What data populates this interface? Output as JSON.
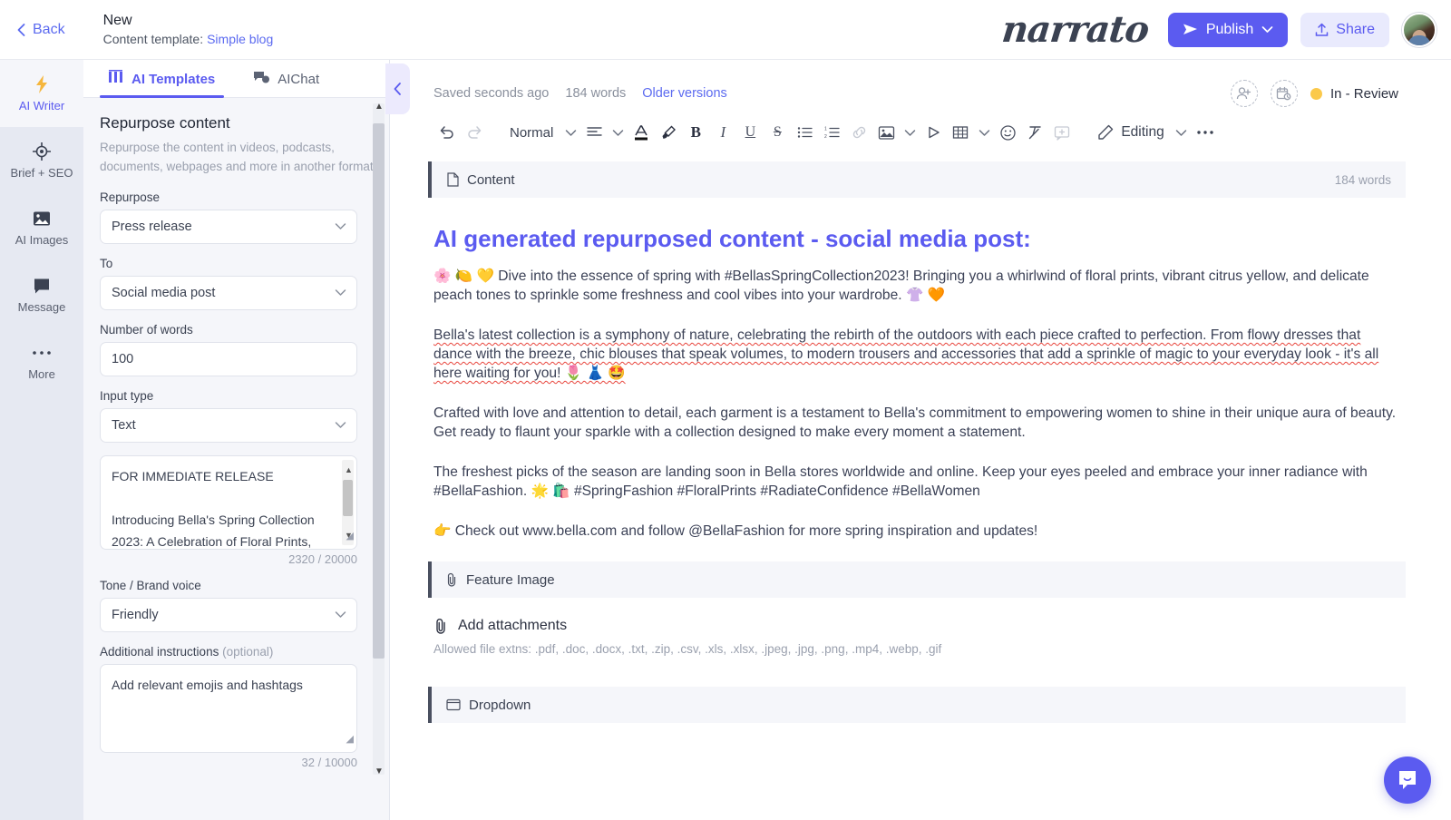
{
  "topbar": {
    "back_label": "Back",
    "doc_title": "New",
    "template_label": "Content template:",
    "template_name": "Simple blog",
    "brand": "narrato",
    "publish_label": "Publish",
    "share_label": "Share",
    "accent": "#5b5bf0"
  },
  "rail": {
    "items": [
      {
        "label": "AI Writer",
        "icon": "lightning-icon",
        "active": true
      },
      {
        "label": "Brief + SEO",
        "icon": "target-icon",
        "active": false
      },
      {
        "label": "AI Images",
        "icon": "image-icon",
        "active": false
      },
      {
        "label": "Message",
        "icon": "chat-icon",
        "active": false
      },
      {
        "label": "More",
        "icon": "ellipsis-icon",
        "active": false
      }
    ]
  },
  "panel": {
    "tabs": [
      {
        "label": "AI Templates",
        "icon": "grid-icon",
        "active": true
      },
      {
        "label": "AIChat",
        "icon": "chat-bubbles-icon",
        "active": false
      }
    ],
    "template_title": "Repurpose content",
    "template_desc": "Repurpose the content in videos, podcasts, documents, webpages and more in another format",
    "fields": {
      "repurpose_label": "Repurpose",
      "repurpose_value": "Press release",
      "to_label": "To",
      "to_value": "Social media post",
      "words_label": "Number of words",
      "words_value": "100",
      "input_type_label": "Input type",
      "input_type_value": "Text",
      "source_line1": "FOR IMMEDIATE RELEASE",
      "source_line2": "Introducing Bella's Spring Collection",
      "source_line3": "2023: A Celebration of Floral Prints,",
      "source_count": "2320 / 20000",
      "tone_label": "Tone / Brand voice",
      "tone_value": "Friendly",
      "instructions_label": "Additional instructions",
      "instructions_optional": "(optional)",
      "instructions_value": "Add relevant emojis and hashtags",
      "instructions_count": "32 / 10000"
    }
  },
  "editor": {
    "saved_text": "Saved seconds ago",
    "word_count": "184 words",
    "older_versions": "Older versions",
    "status_label": "In - Review",
    "status_color": "#fbc94b",
    "toolbar": {
      "undo": "undo-icon",
      "redo": "redo-icon",
      "style_value": "Normal",
      "editing_label": "Editing"
    },
    "content_block": {
      "title": "Content",
      "word_count": "184 words"
    },
    "heading": "AI generated repurposed content - social media post:",
    "paragraphs": [
      "🌸 🍋 💛 Dive into the essence of spring with #BellasSpringCollection2023! Bringing you a whirlwind of floral prints, vibrant citrus yellow, and delicate peach tones to sprinkle some freshness and cool vibes into your wardrobe. 👚 🧡",
      "Bella's latest collection is a symphony of nature, celebrating the rebirth of the outdoors with each piece crafted to perfection. From flowy dresses that dance with the breeze, chic blouses that speak volumes, to modern trousers and accessories that add a sprinkle of magic to your everyday look - it's all here waiting for you! 🌷 👗 🤩",
      "Crafted with love and attention to detail, each garment is a testament to Bella's commitment to empowering women to shine in their unique aura of beauty. Get ready to flaunt your sparkle with a collection designed to make every moment a statement.",
      "The freshest picks of the season are landing soon in Bella stores worldwide and online. Keep your eyes peeled and embrace your inner radiance with #BellaFashion. 🌟 🛍️ #SpringFashion #FloralPrints #RadiateConfidence #BellaWomen",
      "👉 Check out www.bella.com and follow @BellaFashion for more spring inspiration and updates!"
    ],
    "feature_block": {
      "title": "Feature Image"
    },
    "attachments": {
      "add_label": "Add attachments",
      "note": "Allowed file extns: .pdf, .doc, .docx, .txt, .zip, .csv, .xls, .xlsx, .jpeg, .jpg, .png, .mp4, .webp, .gif"
    },
    "dropdown_block": {
      "title": "Dropdown"
    }
  }
}
